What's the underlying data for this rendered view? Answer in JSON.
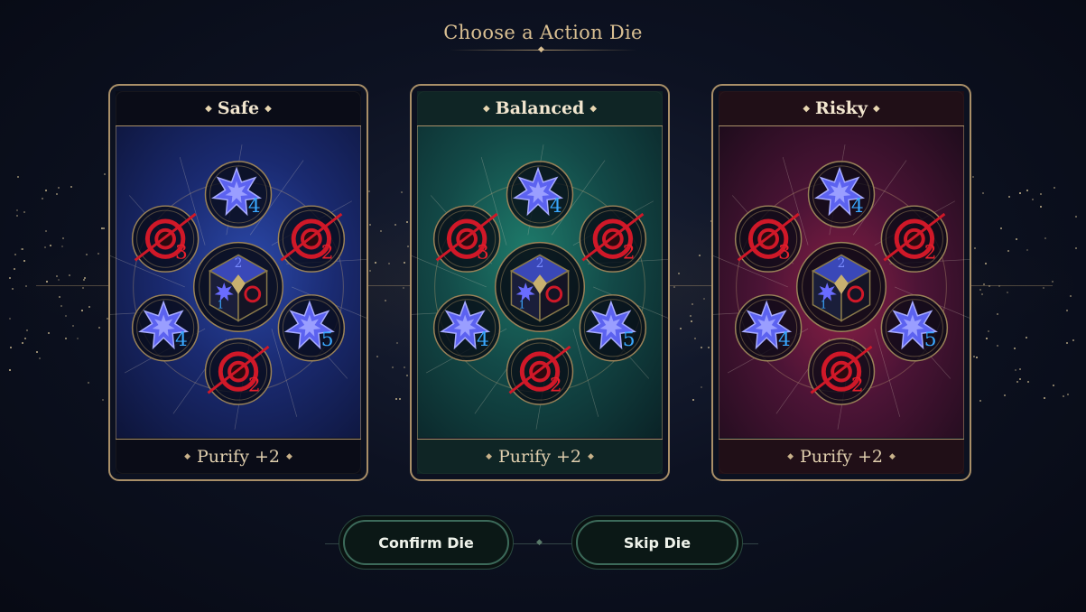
{
  "header": {
    "title": "Choose a Action Die"
  },
  "cards": [
    {
      "title": "Safe",
      "footer": "Purify +2",
      "theme": "blue",
      "faces": {
        "top": "4",
        "upper_left": "3",
        "upper_right": "2",
        "lower_left": "4",
        "lower_right": "5",
        "bottom": "2"
      }
    },
    {
      "title": "Balanced",
      "footer": "Purify +2",
      "theme": "teal",
      "faces": {
        "top": "4",
        "upper_left": "3",
        "upper_right": "2",
        "lower_left": "4",
        "lower_right": "5",
        "bottom": "2"
      }
    },
    {
      "title": "Risky",
      "footer": "Purify +2",
      "theme": "crimson",
      "faces": {
        "top": "4",
        "upper_left": "3",
        "upper_right": "2",
        "lower_left": "4",
        "lower_right": "5",
        "bottom": "2"
      }
    }
  ],
  "die_center": {
    "top_value": "2",
    "left_value": "1"
  },
  "buttons": {
    "confirm": "Confirm Die",
    "skip": "Skip Die"
  },
  "colors": {
    "gold": "#a98f68",
    "blue_face": "#6a6cff",
    "red_face": "#d01828",
    "blue_number": "#3aa8ff",
    "red_number": "#e8202c"
  },
  "icons": {
    "blue_face_icon": "star-burst-icon",
    "red_face_icon": "eye-sigil-icon",
    "die_icon": "cube-die-icon"
  }
}
